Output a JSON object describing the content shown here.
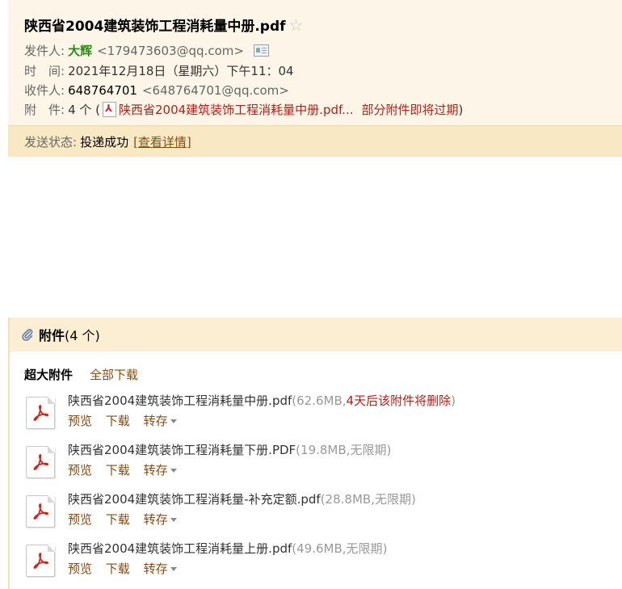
{
  "email": {
    "subject": "陕西省2004建筑装饰工程消耗量中册.pdf",
    "sender_label": "发件人:",
    "sender_name": "大辉",
    "sender_email": "<179473603@qq.com>",
    "time_label": "时　间:",
    "time_value": "2021年12月18日（星期六）下午11：04",
    "recipient_label": "收件人:",
    "recipient_name": "648764701",
    "recipient_email": "<648764701@qq.com>",
    "attachment_label": "附　件:",
    "attachment_count": "4 个 (",
    "attachment_first": "陕西省2004建筑装饰工程消耗量中册.pdf...",
    "attachment_warning": "部分附件即将过期",
    "attachment_close": ")",
    "status_label": "发送状态:",
    "status_value": "投递成功",
    "status_detail": "[查看详情]"
  },
  "attachments_panel": {
    "title": "附件",
    "count": "(4 个)",
    "big_label": "超大附件",
    "download_all": "全部下载",
    "items": [
      {
        "name": "陕西省2004建筑装饰工程消耗量中册.pdf",
        "size": "(62.6MB,",
        "expiry": "4天后该附件将删除",
        "close": ")",
        "preview": "预览",
        "download": "下载",
        "save": "转存"
      },
      {
        "name": "陕西省2004建筑装饰工程消耗量下册.PDF",
        "size": "(19.8MB,",
        "expiry": "无限期",
        "close": ")",
        "preview": "预览",
        "download": "下载",
        "save": "转存"
      },
      {
        "name": "陕西省2004建筑装饰工程消耗量-补充定额.pdf",
        "size": "(28.8MB,",
        "expiry": "无限期",
        "close": ")",
        "preview": "预览",
        "download": "下载",
        "save": "转存"
      },
      {
        "name": "陕西省2004建筑装饰工程消耗量上册.pdf",
        "size": "(49.6MB,",
        "expiry": "无限期",
        "close": ")",
        "preview": "预览",
        "download": "下载",
        "save": "转存"
      }
    ]
  },
  "colors": {
    "header_bg": "#fdf6e8",
    "status_bg": "#f8e8c4",
    "link": "#8a4a10",
    "warning": "#b41e14",
    "sender": "#2b8a1a"
  }
}
